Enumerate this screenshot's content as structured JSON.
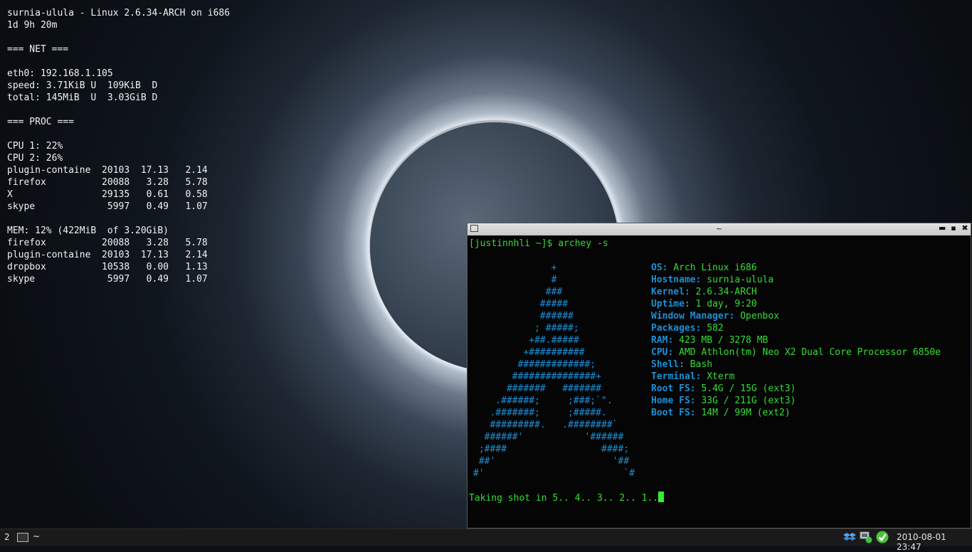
{
  "conky": {
    "lines": [
      "surnia-ulula - Linux 2.6.34-ARCH on i686",
      "1d 9h 20m",
      "",
      "=== NET ===",
      "",
      "eth0: 192.168.1.105",
      "speed: 3.71KiB U  109KiB  D",
      "total: 145MiB  U  3.03GiB D",
      "",
      "=== PROC ===",
      "",
      "CPU 1: 22%",
      "CPU 2: 26%",
      "plugin-containe  20103  17.13   2.14",
      "firefox          20088   3.28   5.78",
      "X                29135   0.61   0.58",
      "skype             5997   0.49   1.07",
      "",
      "MEM: 12% (422MiB  of 3.20GiB)",
      "firefox          20088   3.28   5.78",
      "plugin-containe  20103  17.13   2.14",
      "dropbox          10538   0.00   1.13",
      "skype             5997   0.49   1.07"
    ]
  },
  "terminal": {
    "title": "~",
    "buttons": {
      "minimize": "▬",
      "maximize": "▪",
      "close": "✖"
    },
    "prompt": "[justinnhli ~]$ archey -s",
    "logo": [
      "              +",
      "              #",
      "             ###",
      "            #####",
      "            ######",
      "           ; #####;",
      "          +##.#####",
      "         +##########",
      "        #############;",
      "       ###############+",
      "      #######   #######",
      "    .######;     ;###;`\".",
      "   .#######;     ;#####.",
      "   #########.   .########`",
      "  ######'           '######",
      " ;####                 ####;",
      " ##'                     '##",
      "#'                         `#"
    ],
    "info": [
      {
        "key": "OS:",
        "value": "Arch Linux i686"
      },
      {
        "key": "Hostname:",
        "value": "surnia-ulula"
      },
      {
        "key": "Kernel:",
        "value": "2.6.34-ARCH"
      },
      {
        "key": "Uptime:",
        "value": "1 day, 9:20"
      },
      {
        "key": "Window Manager:",
        "value": "Openbox"
      },
      {
        "key": "Packages:",
        "value": "582"
      },
      {
        "key": "RAM:",
        "value": "423 MB / 3278 MB"
      },
      {
        "key": "CPU:",
        "value": "AMD Athlon(tm) Neo X2 Dual Core Processor 6850e"
      },
      {
        "key": "Shell:",
        "value": "Bash"
      },
      {
        "key": "Terminal:",
        "value": "Xterm"
      },
      {
        "key": "Root FS:",
        "value": "5.4G / 15G (ext3)"
      },
      {
        "key": "Home FS:",
        "value": "33G / 211G (ext3)"
      },
      {
        "key": "Boot FS:",
        "value": "14M / 99M (ext2)"
      }
    ],
    "countdown": "Taking shot in 5.. 4.. 3.. 2.. 1.."
  },
  "taskbar": {
    "desktop_number": "2",
    "task_label": "~",
    "clock": "2010-08-01 23:47",
    "tray_icons": [
      "dropbox-icon",
      "network-icon",
      "checkmark-icon"
    ]
  },
  "colors": {
    "terminal_green": "#33dd33",
    "terminal_blue": "#1b8fd6",
    "conky_text": "#f2f2f2"
  }
}
